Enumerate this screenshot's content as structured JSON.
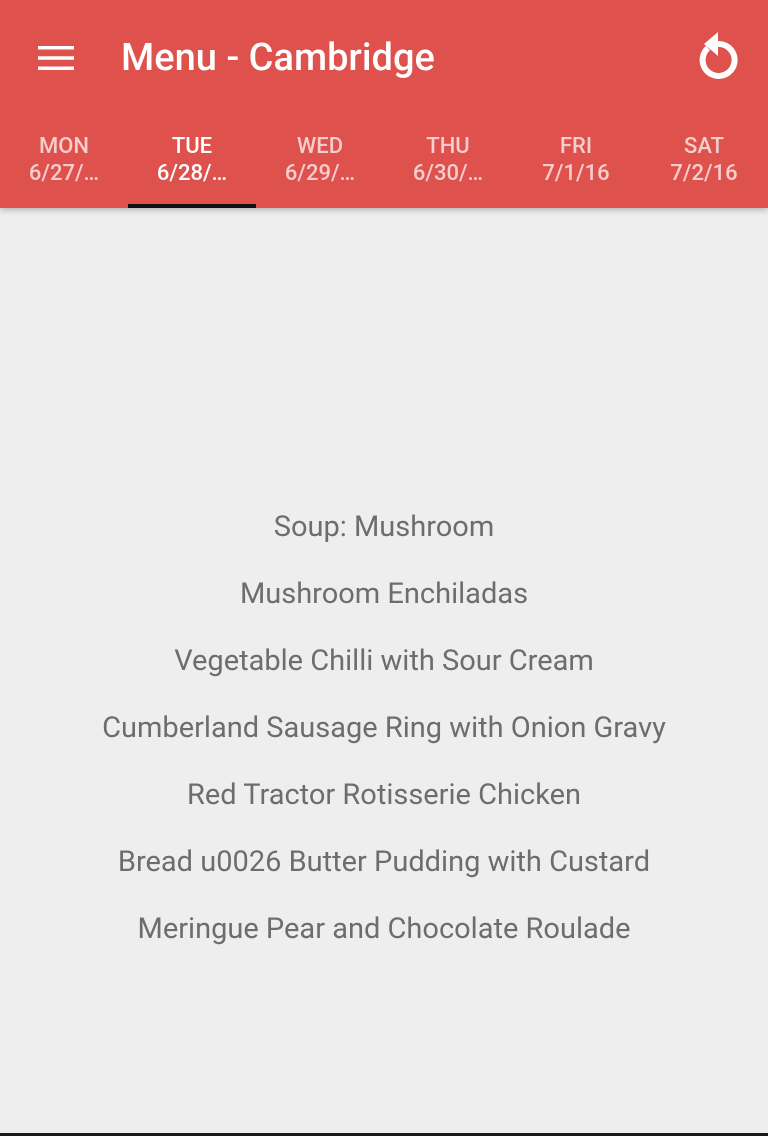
{
  "header": {
    "title": "Menu - Cambridge",
    "menu_icon": "hamburger-menu-icon",
    "refresh_icon": "refresh-icon",
    "background_color": "#df514c"
  },
  "tabs": [
    {
      "day": "MON",
      "date": "6/27/…",
      "active": false
    },
    {
      "day": "TUE",
      "date": "6/28/…",
      "active": true
    },
    {
      "day": "WED",
      "date": "6/29/…",
      "active": false
    },
    {
      "day": "THU",
      "date": "6/30/…",
      "active": false
    },
    {
      "day": "FRI",
      "date": "7/1/16",
      "active": false
    },
    {
      "day": "SAT",
      "date": "7/2/16",
      "active": false
    }
  ],
  "menu_items": [
    "Soup: Mushroom",
    "Mushroom Enchiladas",
    "Vegetable Chilli with Sour Cream",
    "Cumberland Sausage Ring with Onion Gravy",
    "Red Tractor Rotisserie Chicken",
    "Bread u0026 Butter Pudding with Custard",
    "Meringue Pear and Chocolate Roulade"
  ]
}
